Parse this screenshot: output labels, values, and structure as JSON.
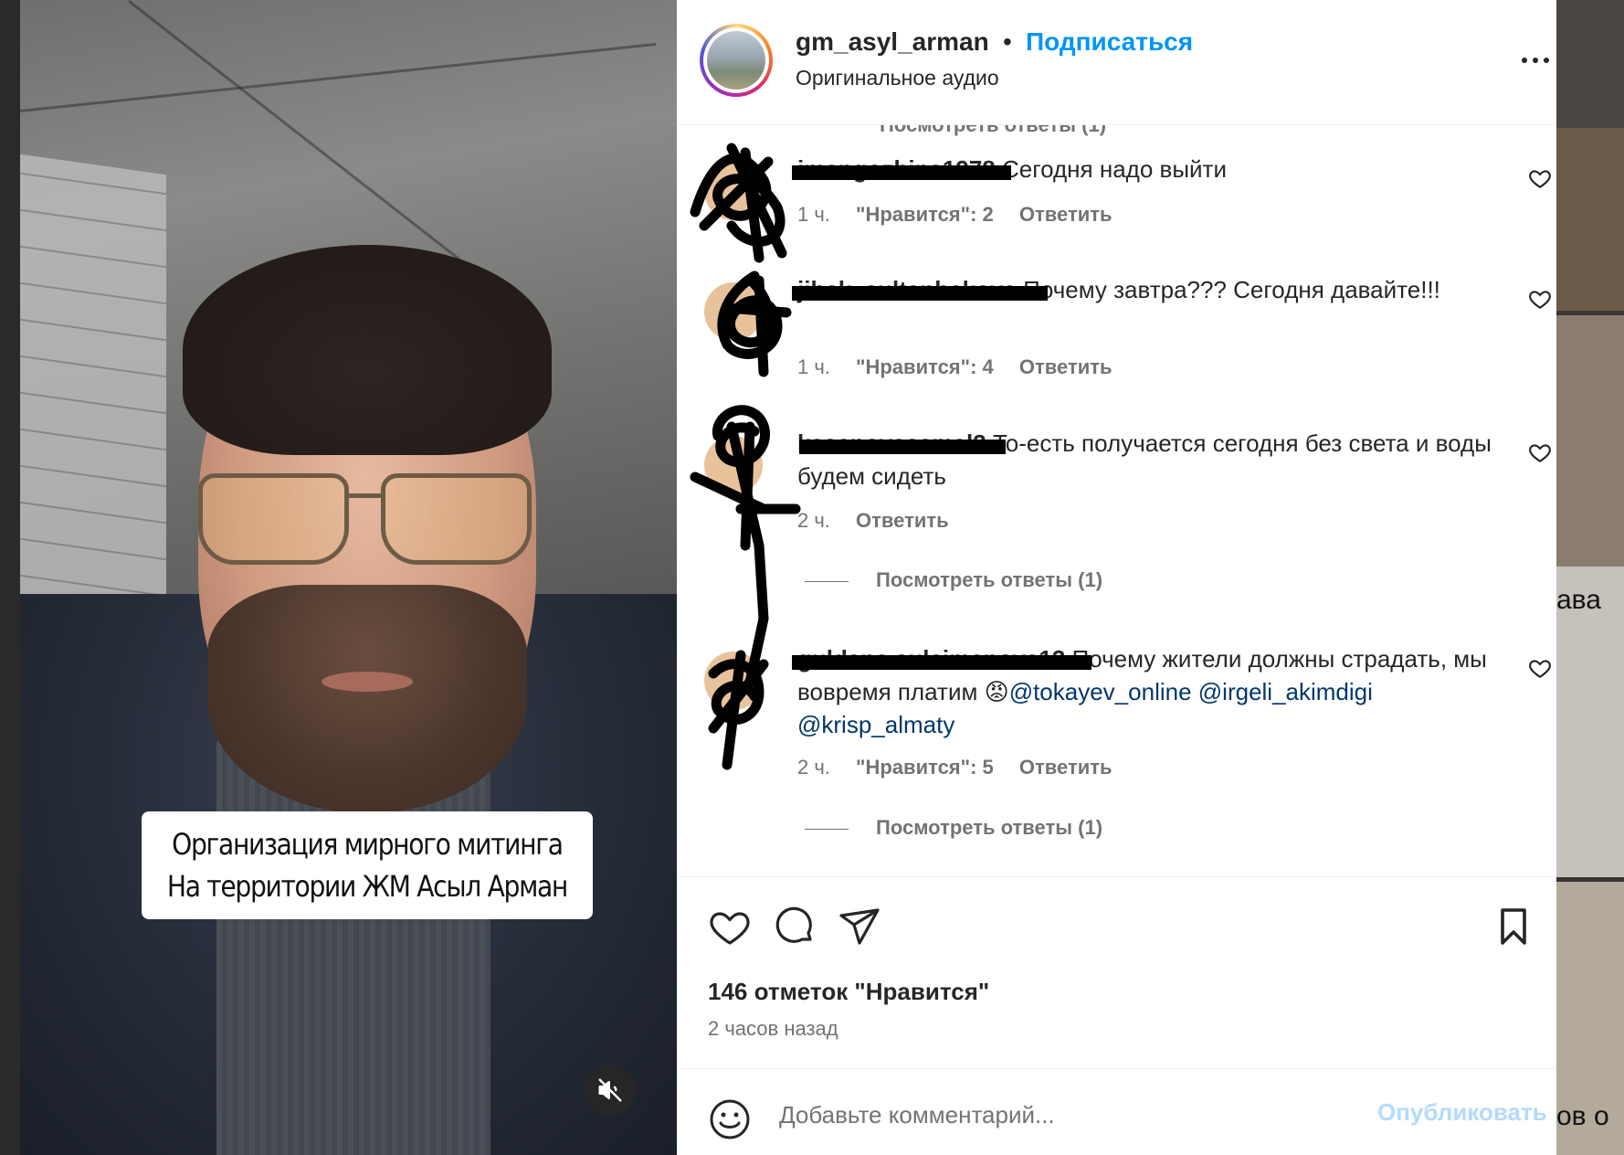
{
  "post": {
    "username": "gm_asyl_arman",
    "separator": "•",
    "follow_label": "Подписаться",
    "audio_label": "Оригинальное аудио"
  },
  "video": {
    "caption_line1": "Организация мирного митинга",
    "caption_line2": "На территории ЖМ Асыл Арман",
    "muted": true
  },
  "comments_cut_text": "Посмотреть ответы (1)",
  "comments": [
    {
      "username": "imangozhina1978",
      "text": "Сегодня надо выйти",
      "time": "1 ч.",
      "likes_label": "\"Нравится\": 2",
      "reply_label": "Ответить"
    },
    {
      "username": "jibek_sultanbekova",
      "text": "Почему завтра??? Сегодня давайте!!!",
      "time": "1 ч.",
      "likes_label": "\"Нравится\": 4",
      "reply_label": "Ответить"
    },
    {
      "username": "kasenovasamal3",
      "text": "То-есть получается сегодня без света и воды будем сидеть",
      "time": "2 ч.",
      "reply_label": "Ответить",
      "view_replies": "Посмотреть ответы (1)"
    },
    {
      "username": "guldana.suleimenova13",
      "text_before": "Почему жители должны страдать, мы вовремя платим",
      "emoji": "😡",
      "mentions": [
        "@tokayev_online",
        "@irgeli_akimdigi",
        "@krisp_almaty"
      ],
      "time": "2 ч.",
      "likes_label": "\"Нравится\": 5",
      "reply_label": "Ответить",
      "view_replies": "Посмотреть ответы (1)"
    }
  ],
  "actions": {
    "likes_count": "146 отметок \"Нравится\"",
    "time_ago": "2 часов назад",
    "icons": [
      "heart-icon",
      "comment-icon",
      "share-icon",
      "bookmark-icon"
    ]
  },
  "comment_box": {
    "placeholder": "Добавьте комментарий...",
    "publish_label": "Опубликовать"
  },
  "right_strip": {
    "text_fragment_1": "ава",
    "text_fragment_2": "ов о"
  },
  "colors": {
    "accent": "#0095f6",
    "mention": "#00376b",
    "muted_text": "#737373",
    "publish_disabled": "#b3dbff"
  }
}
